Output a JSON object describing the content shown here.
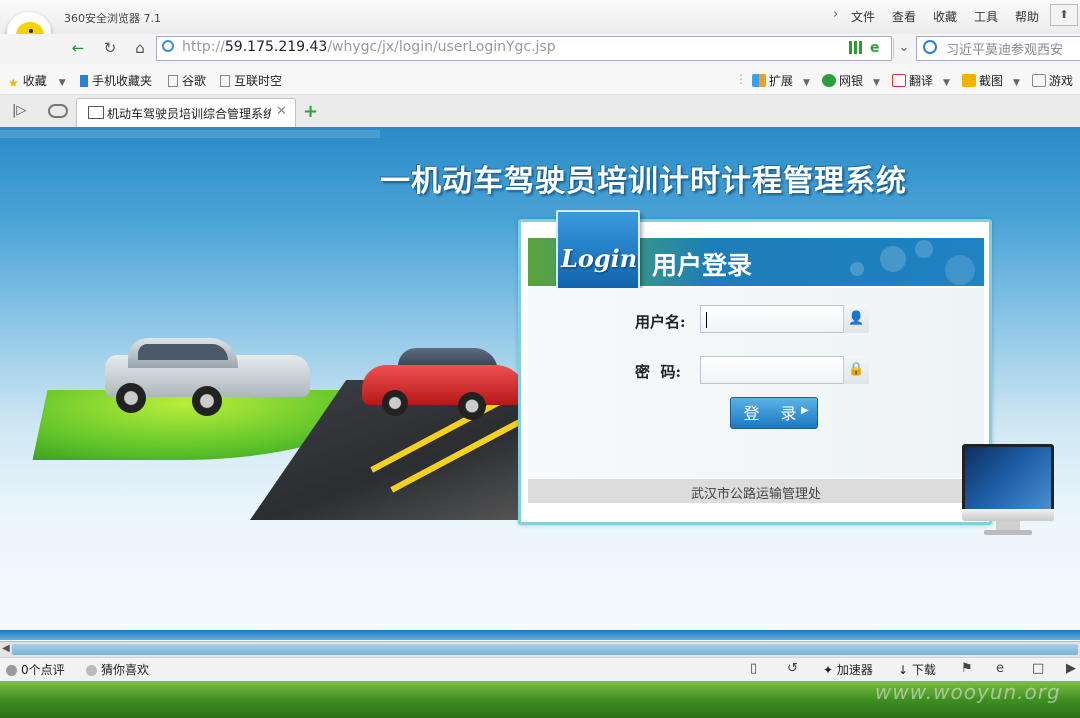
{
  "browser": {
    "app_title": "360安全浏览器 7.1",
    "menu": [
      "文件",
      "查看",
      "收藏",
      "工具",
      "帮助"
    ],
    "address": {
      "prefix": "http://",
      "host": "59.175.219.43",
      "path": "/whygc/jx/login/userLoginYgc.jsp"
    },
    "search_placeholder": "习近平莫迪参观西安",
    "favorites": [
      "收藏",
      "手机收藏夹",
      "谷歌",
      "互联时空"
    ],
    "toolbar": [
      "扩展",
      "网银",
      "翻译",
      "截图",
      "游戏"
    ],
    "tab_title": "机动车驾驶员培训综合管理系统",
    "status": {
      "comments": "0个点评",
      "guess": "猜你喜欢",
      "accelerator": "加速器",
      "download": "下载"
    }
  },
  "page": {
    "headline": "一机动车驾驶员培训计时计程管理系统",
    "login_badge": "Login",
    "panel_title": "用户登录",
    "username_label": "用户名:",
    "password_label": "密  码:",
    "login_button": "登 录",
    "footer": "武汉市公路运输管理处"
  },
  "watermark": "www.wooyun.org",
  "colors": {
    "brand_blue": "#1f82c3",
    "panel_border": "#7fd0dc",
    "button": "#1d77bf",
    "add_tab": "#2aa43a"
  }
}
